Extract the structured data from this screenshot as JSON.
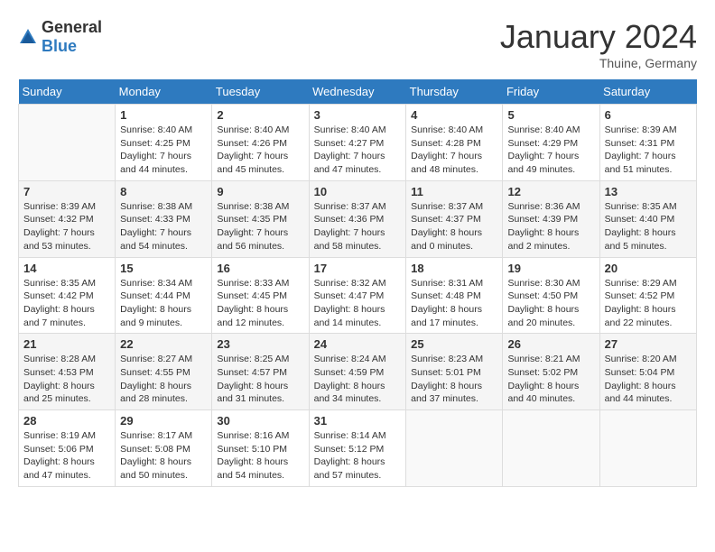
{
  "header": {
    "logo_general": "General",
    "logo_blue": "Blue",
    "month": "January 2024",
    "location": "Thuine, Germany"
  },
  "days_of_week": [
    "Sunday",
    "Monday",
    "Tuesday",
    "Wednesday",
    "Thursday",
    "Friday",
    "Saturday"
  ],
  "weeks": [
    [
      {
        "day": "",
        "sunrise": "",
        "sunset": "",
        "daylight": ""
      },
      {
        "day": "1",
        "sunrise": "Sunrise: 8:40 AM",
        "sunset": "Sunset: 4:25 PM",
        "daylight": "Daylight: 7 hours and 44 minutes."
      },
      {
        "day": "2",
        "sunrise": "Sunrise: 8:40 AM",
        "sunset": "Sunset: 4:26 PM",
        "daylight": "Daylight: 7 hours and 45 minutes."
      },
      {
        "day": "3",
        "sunrise": "Sunrise: 8:40 AM",
        "sunset": "Sunset: 4:27 PM",
        "daylight": "Daylight: 7 hours and 47 minutes."
      },
      {
        "day": "4",
        "sunrise": "Sunrise: 8:40 AM",
        "sunset": "Sunset: 4:28 PM",
        "daylight": "Daylight: 7 hours and 48 minutes."
      },
      {
        "day": "5",
        "sunrise": "Sunrise: 8:40 AM",
        "sunset": "Sunset: 4:29 PM",
        "daylight": "Daylight: 7 hours and 49 minutes."
      },
      {
        "day": "6",
        "sunrise": "Sunrise: 8:39 AM",
        "sunset": "Sunset: 4:31 PM",
        "daylight": "Daylight: 7 hours and 51 minutes."
      }
    ],
    [
      {
        "day": "7",
        "sunrise": "Sunrise: 8:39 AM",
        "sunset": "Sunset: 4:32 PM",
        "daylight": "Daylight: 7 hours and 53 minutes."
      },
      {
        "day": "8",
        "sunrise": "Sunrise: 8:38 AM",
        "sunset": "Sunset: 4:33 PM",
        "daylight": "Daylight: 7 hours and 54 minutes."
      },
      {
        "day": "9",
        "sunrise": "Sunrise: 8:38 AM",
        "sunset": "Sunset: 4:35 PM",
        "daylight": "Daylight: 7 hours and 56 minutes."
      },
      {
        "day": "10",
        "sunrise": "Sunrise: 8:37 AM",
        "sunset": "Sunset: 4:36 PM",
        "daylight": "Daylight: 7 hours and 58 minutes."
      },
      {
        "day": "11",
        "sunrise": "Sunrise: 8:37 AM",
        "sunset": "Sunset: 4:37 PM",
        "daylight": "Daylight: 8 hours and 0 minutes."
      },
      {
        "day": "12",
        "sunrise": "Sunrise: 8:36 AM",
        "sunset": "Sunset: 4:39 PM",
        "daylight": "Daylight: 8 hours and 2 minutes."
      },
      {
        "day": "13",
        "sunrise": "Sunrise: 8:35 AM",
        "sunset": "Sunset: 4:40 PM",
        "daylight": "Daylight: 8 hours and 5 minutes."
      }
    ],
    [
      {
        "day": "14",
        "sunrise": "Sunrise: 8:35 AM",
        "sunset": "Sunset: 4:42 PM",
        "daylight": "Daylight: 8 hours and 7 minutes."
      },
      {
        "day": "15",
        "sunrise": "Sunrise: 8:34 AM",
        "sunset": "Sunset: 4:44 PM",
        "daylight": "Daylight: 8 hours and 9 minutes."
      },
      {
        "day": "16",
        "sunrise": "Sunrise: 8:33 AM",
        "sunset": "Sunset: 4:45 PM",
        "daylight": "Daylight: 8 hours and 12 minutes."
      },
      {
        "day": "17",
        "sunrise": "Sunrise: 8:32 AM",
        "sunset": "Sunset: 4:47 PM",
        "daylight": "Daylight: 8 hours and 14 minutes."
      },
      {
        "day": "18",
        "sunrise": "Sunrise: 8:31 AM",
        "sunset": "Sunset: 4:48 PM",
        "daylight": "Daylight: 8 hours and 17 minutes."
      },
      {
        "day": "19",
        "sunrise": "Sunrise: 8:30 AM",
        "sunset": "Sunset: 4:50 PM",
        "daylight": "Daylight: 8 hours and 20 minutes."
      },
      {
        "day": "20",
        "sunrise": "Sunrise: 8:29 AM",
        "sunset": "Sunset: 4:52 PM",
        "daylight": "Daylight: 8 hours and 22 minutes."
      }
    ],
    [
      {
        "day": "21",
        "sunrise": "Sunrise: 8:28 AM",
        "sunset": "Sunset: 4:53 PM",
        "daylight": "Daylight: 8 hours and 25 minutes."
      },
      {
        "day": "22",
        "sunrise": "Sunrise: 8:27 AM",
        "sunset": "Sunset: 4:55 PM",
        "daylight": "Daylight: 8 hours and 28 minutes."
      },
      {
        "day": "23",
        "sunrise": "Sunrise: 8:25 AM",
        "sunset": "Sunset: 4:57 PM",
        "daylight": "Daylight: 8 hours and 31 minutes."
      },
      {
        "day": "24",
        "sunrise": "Sunrise: 8:24 AM",
        "sunset": "Sunset: 4:59 PM",
        "daylight": "Daylight: 8 hours and 34 minutes."
      },
      {
        "day": "25",
        "sunrise": "Sunrise: 8:23 AM",
        "sunset": "Sunset: 5:01 PM",
        "daylight": "Daylight: 8 hours and 37 minutes."
      },
      {
        "day": "26",
        "sunrise": "Sunrise: 8:21 AM",
        "sunset": "Sunset: 5:02 PM",
        "daylight": "Daylight: 8 hours and 40 minutes."
      },
      {
        "day": "27",
        "sunrise": "Sunrise: 8:20 AM",
        "sunset": "Sunset: 5:04 PM",
        "daylight": "Daylight: 8 hours and 44 minutes."
      }
    ],
    [
      {
        "day": "28",
        "sunrise": "Sunrise: 8:19 AM",
        "sunset": "Sunset: 5:06 PM",
        "daylight": "Daylight: 8 hours and 47 minutes."
      },
      {
        "day": "29",
        "sunrise": "Sunrise: 8:17 AM",
        "sunset": "Sunset: 5:08 PM",
        "daylight": "Daylight: 8 hours and 50 minutes."
      },
      {
        "day": "30",
        "sunrise": "Sunrise: 8:16 AM",
        "sunset": "Sunset: 5:10 PM",
        "daylight": "Daylight: 8 hours and 54 minutes."
      },
      {
        "day": "31",
        "sunrise": "Sunrise: 8:14 AM",
        "sunset": "Sunset: 5:12 PM",
        "daylight": "Daylight: 8 hours and 57 minutes."
      },
      {
        "day": "",
        "sunrise": "",
        "sunset": "",
        "daylight": ""
      },
      {
        "day": "",
        "sunrise": "",
        "sunset": "",
        "daylight": ""
      },
      {
        "day": "",
        "sunrise": "",
        "sunset": "",
        "daylight": ""
      }
    ]
  ]
}
